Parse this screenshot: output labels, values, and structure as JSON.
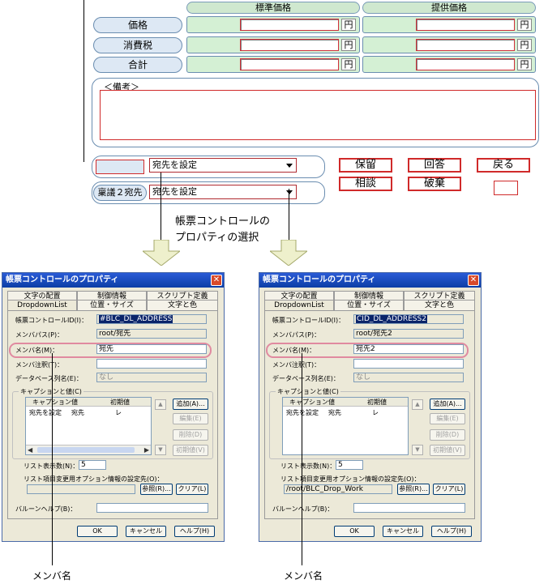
{
  "form": {
    "col_headers": [
      "標準価格",
      "提供価格"
    ],
    "rows": [
      {
        "label": "価格",
        "unit": "円"
      },
      {
        "label": "消費税",
        "unit": "円"
      },
      {
        "label": "合計",
        "unit": "円"
      }
    ],
    "remarks_label": "＜備考＞",
    "dropdown1_value": "宛先を設定",
    "dropdown2_value": "宛先を設定",
    "row2_label": "稟議２宛先",
    "buttons": {
      "hold": "保留",
      "answer": "回答",
      "back": "戻る",
      "consult": "相談",
      "discard": "破棄"
    }
  },
  "callout": {
    "line1": "帳票コントロールの",
    "line2": "プロパティの選択"
  },
  "dialogs": [
    {
      "title": "帳票コントロールのプロパティ",
      "tabs_back": [
        "文字の配置",
        "制御情報",
        "スクリプト定義"
      ],
      "tabs_front": [
        "DropdownList",
        "位置・サイズ",
        "文字と色"
      ],
      "id_label": "帳票コントロールID(I)：",
      "id_value": "#BLC_DL_ADDRESS",
      "path_label": "メンバパス(P)：",
      "path_value": "root/宛先",
      "name_label": "メンバ名(M)：",
      "name_value": "宛先",
      "comment_label": "メンバ注釈(T)：",
      "comment_value": "",
      "db_label": "データベース列名(E)：",
      "db_value": "なし",
      "cv_group": "キャプションと値(C)",
      "list_headers": [
        "キャプション",
        "値",
        "初期値"
      ],
      "list_row": [
        "宛先を設定",
        "宛先",
        "レ"
      ],
      "side_buttons": [
        "追加(A)...",
        "編集(E)",
        "削除(D)",
        "初期値(V)"
      ],
      "rows_label": "リスト表示数(N)：",
      "rows_value": "5",
      "opt_label": "リスト項目変更用オプション情報の設定先(O)：",
      "opt_value": "",
      "ref_button": "参照(R)...",
      "clear_button": "クリア(L)",
      "balloon_label": "バルーンヘルプ(B)：",
      "ok": "OK",
      "cancel": "キャンセル",
      "help": "ヘルプ(H)"
    },
    {
      "title": "帳票コントロールのプロパティ",
      "tabs_back": [
        "文字の配置",
        "制御情報",
        "スクリプト定義"
      ],
      "tabs_front": [
        "DropdownList",
        "位置・サイズ",
        "文字と色"
      ],
      "id_label": "帳票コントロールID(I)：",
      "id_value": "CID_DL_ADDRESS2",
      "path_label": "メンバパス(P)：",
      "path_value": "root/宛先2",
      "name_label": "メンバ名(M)：",
      "name_value": "宛先2",
      "comment_label": "メンバ注釈(T)：",
      "comment_value": "",
      "db_label": "データベース列名(E)：",
      "db_value": "なし",
      "cv_group": "キャプションと値(C)",
      "list_headers": [
        "キャプション",
        "値",
        "初期値"
      ],
      "list_row": [
        "宛先を設定",
        "宛先",
        "レ"
      ],
      "side_buttons": [
        "追加(A)...",
        "編集(E)",
        "削除(D)",
        "初期値(V)"
      ],
      "rows_label": "リスト表示数(N)：",
      "rows_value": "5",
      "opt_label": "リスト項目変更用オプション情報の設定先(O)：",
      "opt_value": "/root/BLC_Drop_Work",
      "ref_button": "参照(R)...",
      "clear_button": "クリア(L)",
      "balloon_label": "バルーンヘルプ(B)：",
      "ok": "OK",
      "cancel": "キャンセル",
      "help": "ヘルプ(H)"
    }
  ],
  "captions": [
    "メンバ名",
    "メンバ名"
  ],
  "colors": {
    "accent_red": "#d02a2a",
    "pill_blue": "#dde8f4",
    "cell_green": "#d4f0d4",
    "highlight_pink": "#e08aa0",
    "title_blue": "#0c3ea6"
  }
}
